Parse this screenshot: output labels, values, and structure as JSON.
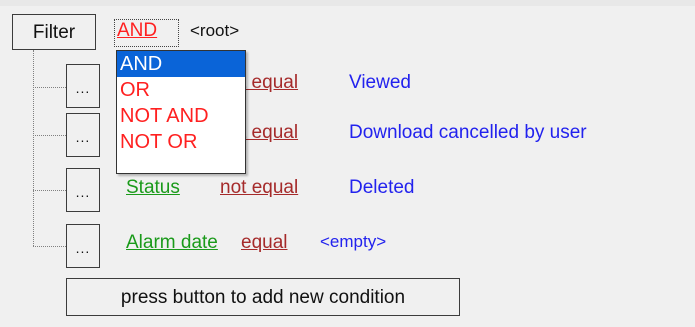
{
  "toolbar": {
    "filter_label": "Filter",
    "operator_label": "AND",
    "root_label": "<root>"
  },
  "operator_menu": {
    "options": [
      "AND",
      "OR",
      "NOT AND",
      "NOT OR"
    ],
    "selected": "AND"
  },
  "conditions": [
    {
      "button": "...",
      "field": "",
      "operator": "t equal",
      "value": "Viewed"
    },
    {
      "button": "...",
      "field": "",
      "operator": "t equal",
      "value": "Download cancelled by user"
    },
    {
      "button": "...",
      "field": "Status",
      "operator": "not equal",
      "value": "Deleted"
    },
    {
      "button": "...",
      "field": "Alarm date",
      "operator": "equal",
      "value": "<empty>"
    }
  ],
  "add_condition_label": "press button to add new condition",
  "colors": {
    "operator": "#ff2020",
    "condition_operator": "#a52a2a",
    "field": "#1a9a1a",
    "value": "#2222ee",
    "menu_selection": "#0a64d8"
  }
}
